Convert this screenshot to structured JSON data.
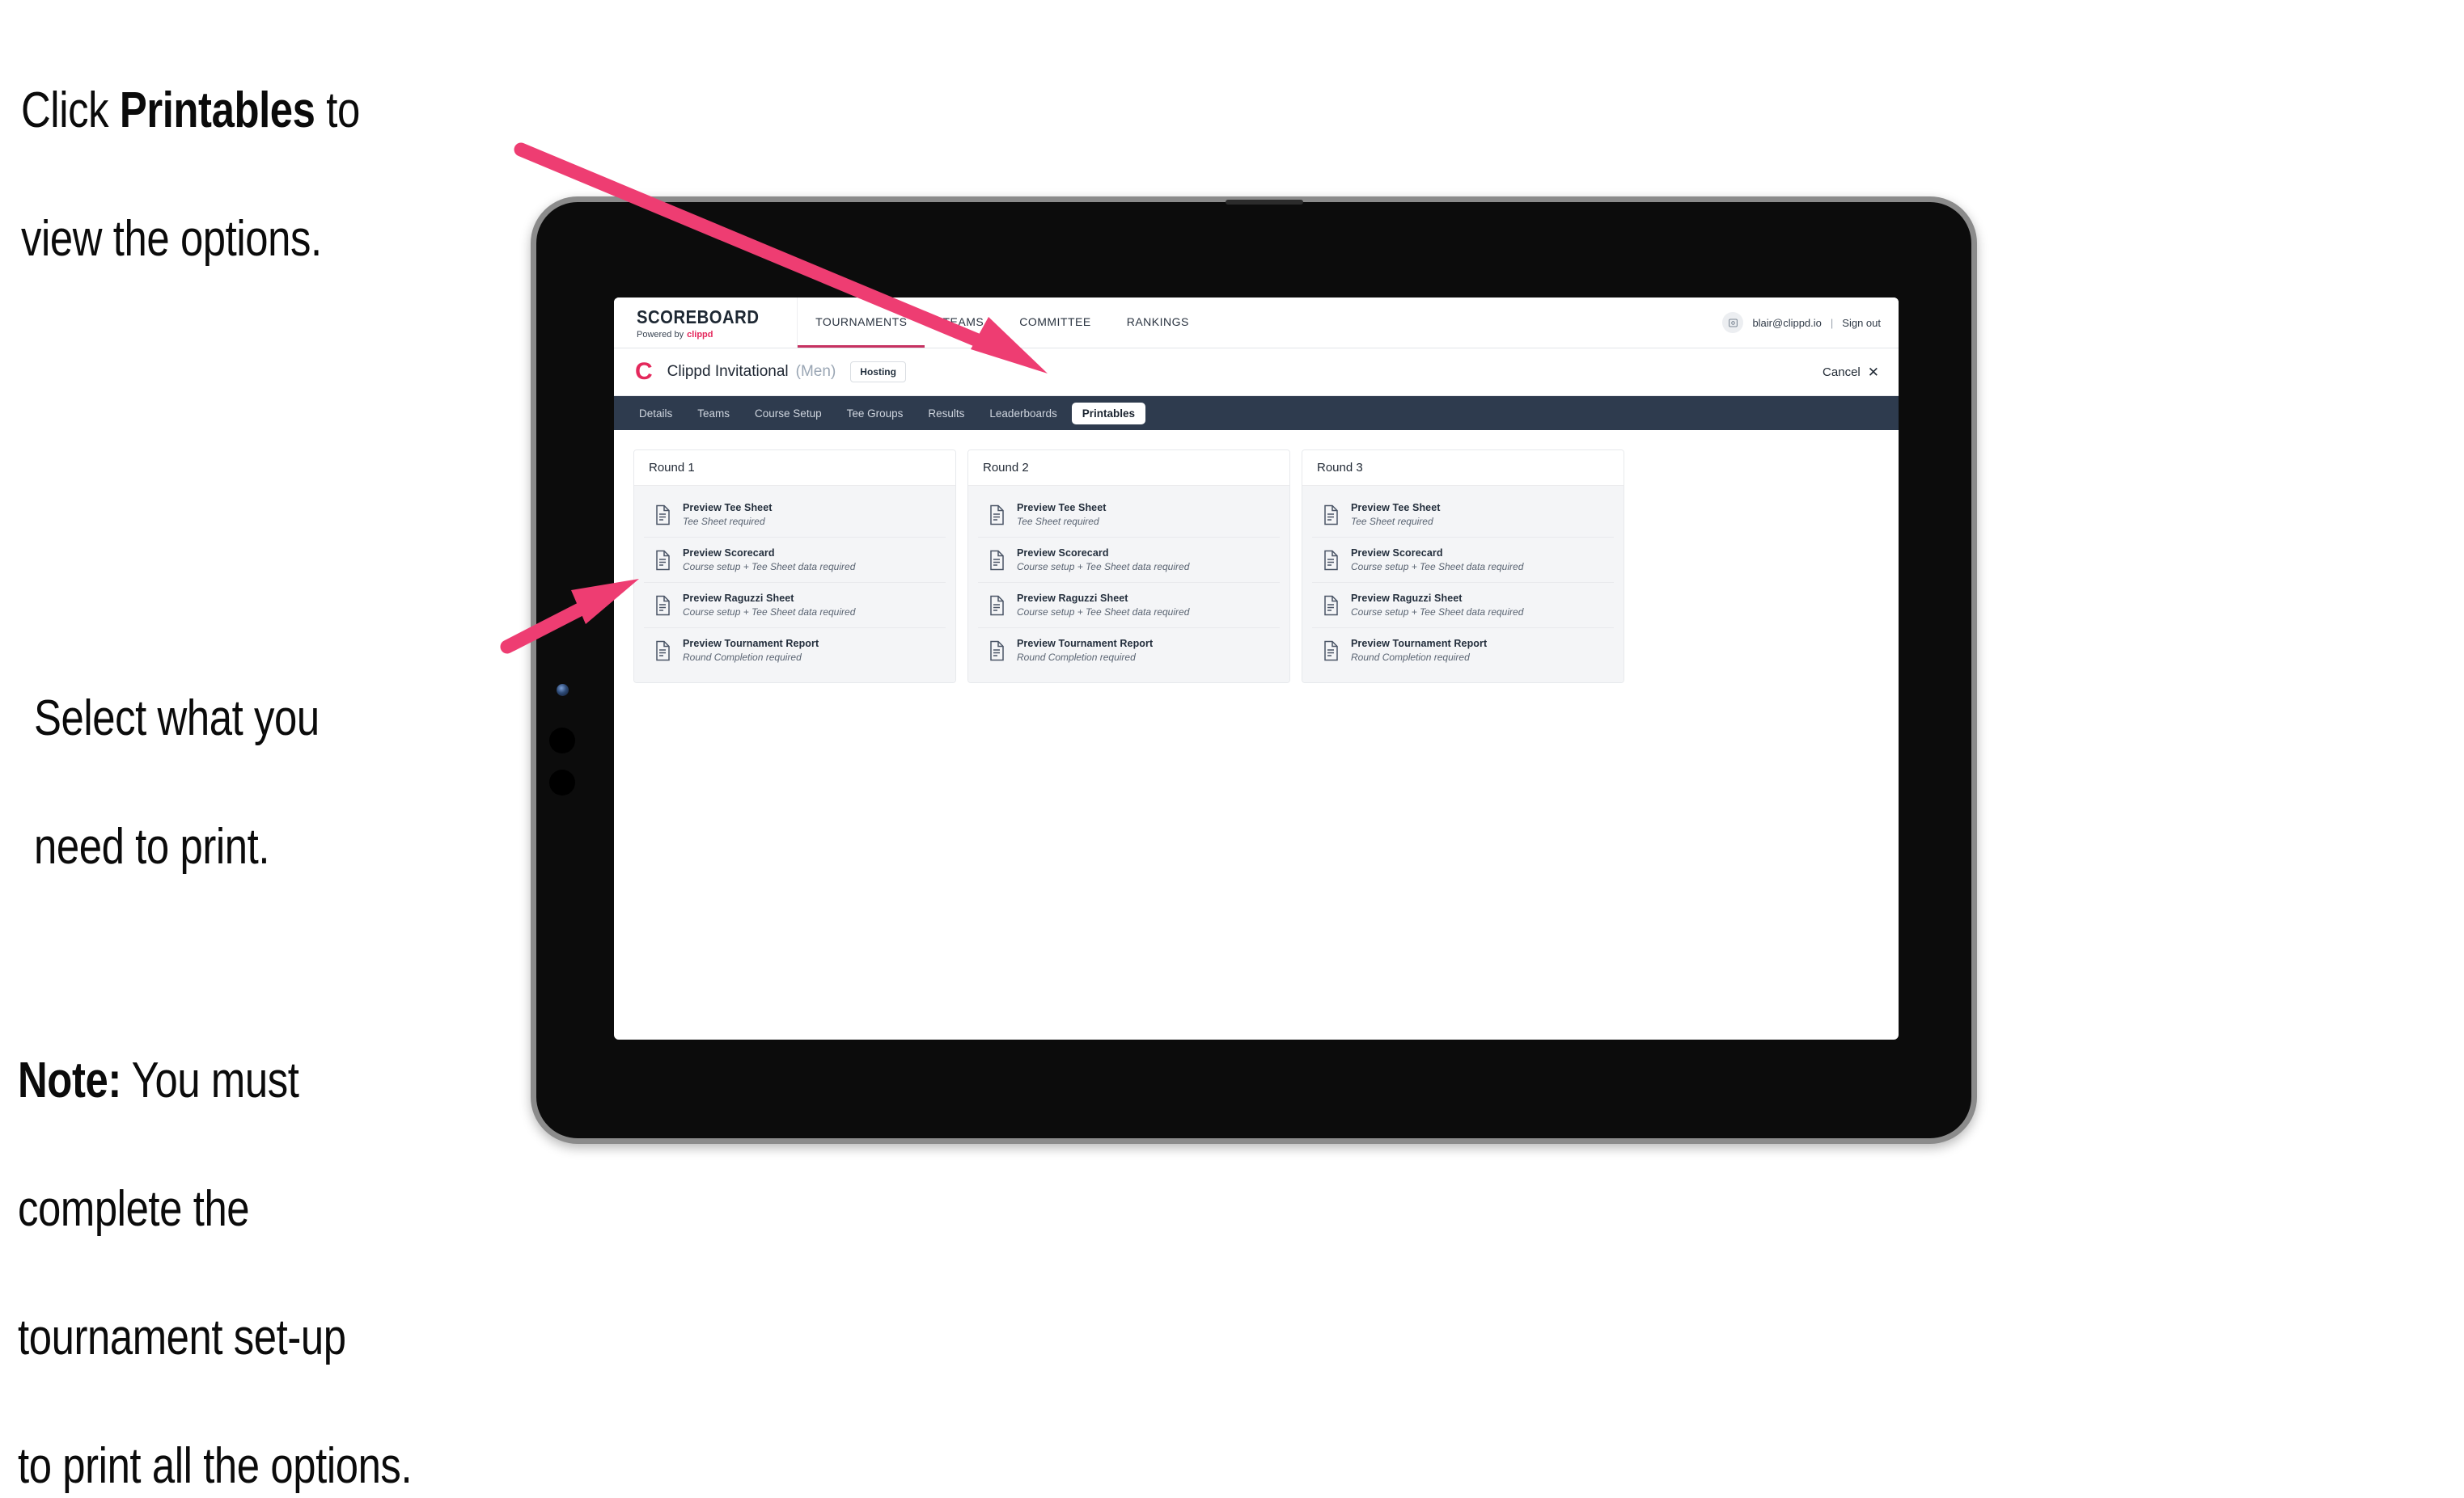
{
  "annotations": [
    {
      "id": "a1",
      "prefix": "Click ",
      "bold": "Printables",
      "suffix": " to\nview the options."
    },
    {
      "id": "a2",
      "prefix": "",
      "bold": "",
      "suffix": "Select what you\n need to print."
    },
    {
      "id": "a3",
      "prefix": "",
      "bold": "Note:",
      "suffix": " You must\ncomplete the\ntournament set-up\nto print all the options."
    }
  ],
  "annotation_text": {
    "line1_a": "Click ",
    "line1_bold": "Printables",
    "line1_b": " to",
    "line2": "view the options.",
    "line3": "Select what you",
    "line4": " need to print.",
    "line5_bold": "Note:",
    "line5_b": " You must",
    "line6": "complete the",
    "line7": "tournament set-up",
    "line8": "to print all the options."
  },
  "colors": {
    "arrow_pink": "#EE3D72",
    "brand_pink": "#E4285C",
    "navbar_dark": "#2E3B4E",
    "active_tab_underline": "#C63161"
  },
  "app": {
    "brand": {
      "title": "SCOREBOARD",
      "powered_prefix": "Powered by",
      "powered_brand": "clippd"
    },
    "topnav": [
      {
        "label": "TOURNAMENTS",
        "active": true
      },
      {
        "label": "TEAMS",
        "active": false
      },
      {
        "label": "COMMITTEE",
        "active": false
      },
      {
        "label": "RANKINGS",
        "active": false
      }
    ],
    "account": {
      "avatar_icon": "user-avatar-icon",
      "email": "blair@clippd.io",
      "separator": "|",
      "sign_out": "Sign out"
    },
    "tournament": {
      "logo_letter": "C",
      "name": "Clippd Invitational",
      "gender": "(Men)",
      "status_badge": "Hosting",
      "cancel_label": "Cancel",
      "cancel_icon": "close-icon"
    },
    "tabs": [
      {
        "label": "Details",
        "active": false
      },
      {
        "label": "Teams",
        "active": false
      },
      {
        "label": "Course Setup",
        "active": false
      },
      {
        "label": "Tee Groups",
        "active": false
      },
      {
        "label": "Results",
        "active": false
      },
      {
        "label": "Leaderboards",
        "active": false
      },
      {
        "label": "Printables",
        "active": true
      }
    ],
    "rounds": [
      {
        "title": "Round 1",
        "items": [
          {
            "title": "Preview Tee Sheet",
            "sub": "Tee Sheet required",
            "icon": "document-icon"
          },
          {
            "title": "Preview Scorecard",
            "sub": "Course setup + Tee Sheet data required",
            "icon": "document-icon"
          },
          {
            "title": "Preview Raguzzi Sheet",
            "sub": "Course setup + Tee Sheet data required",
            "icon": "document-icon"
          },
          {
            "title": "Preview Tournament Report",
            "sub": "Round Completion required",
            "icon": "document-icon"
          }
        ]
      },
      {
        "title": "Round 2",
        "items": [
          {
            "title": "Preview Tee Sheet",
            "sub": "Tee Sheet required",
            "icon": "document-icon"
          },
          {
            "title": "Preview Scorecard",
            "sub": "Course setup + Tee Sheet data required",
            "icon": "document-icon"
          },
          {
            "title": "Preview Raguzzi Sheet",
            "sub": "Course setup + Tee Sheet data required",
            "icon": "document-icon"
          },
          {
            "title": "Preview Tournament Report",
            "sub": "Round Completion required",
            "icon": "document-icon"
          }
        ]
      },
      {
        "title": "Round 3",
        "items": [
          {
            "title": "Preview Tee Sheet",
            "sub": "Tee Sheet required",
            "icon": "document-icon"
          },
          {
            "title": "Preview Scorecard",
            "sub": "Course setup + Tee Sheet data required",
            "icon": "document-icon"
          },
          {
            "title": "Preview Raguzzi Sheet",
            "sub": "Course setup + Tee Sheet data required",
            "icon": "document-icon"
          },
          {
            "title": "Preview Tournament Report",
            "sub": "Round Completion required",
            "icon": "document-icon"
          }
        ]
      }
    ]
  }
}
